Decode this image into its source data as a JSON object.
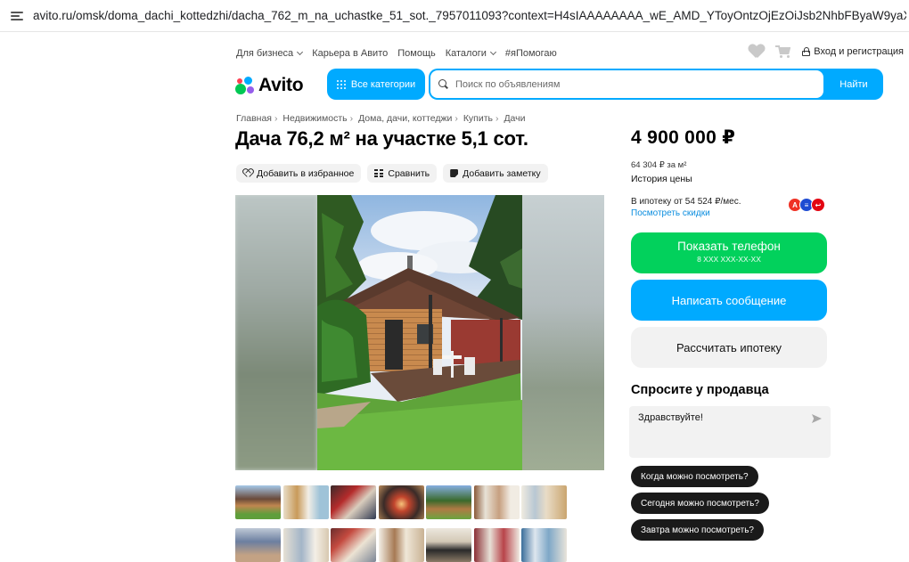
{
  "browser": {
    "url": "avito.ru/omsk/doma_dachi_kottedzhi/dacha_762_m_na_uchastke_51_sot._7957011093?context=H4sIAAAAAAAA_wE_AMD_YToyOntzOjEzOiJsb2NhbFByaW9yaXR5IjtiOjA7czoxOiJ4IjtzOjE2OiI"
  },
  "topnav": {
    "items": [
      {
        "label": "Для бизнеса",
        "dropdown": true
      },
      {
        "label": "Карьера в Авито",
        "dropdown": false
      },
      {
        "label": "Помощь",
        "dropdown": false
      },
      {
        "label": "Каталоги",
        "dropdown": true
      },
      {
        "label": "#яПомогаю",
        "dropdown": false
      }
    ],
    "login_label": "Вход и регистрация"
  },
  "header": {
    "logo_text": "Avito",
    "categories_label": "Все категории",
    "search_placeholder": "Поиск по объявлениям",
    "search_button": "Найти"
  },
  "breadcrumb": [
    "Главная",
    "Недвижимость",
    "Дома, дачи, коттеджи",
    "Купить",
    "Дачи"
  ],
  "listing": {
    "title": "Дача 76,2 м² на участке 5,1 сот.",
    "actions": {
      "favorite": "Добавить в избранное",
      "compare": "Сравнить",
      "note": "Добавить заметку"
    }
  },
  "sidebar": {
    "price": "4 900 000 ₽",
    "price_per_m": "64 304 ₽ за м²",
    "price_history": "История цены",
    "mortgage": "В ипотеку от 54 524 ₽/мес.",
    "discounts_link": "Посмотреть скидки",
    "banks": [
      {
        "letter": "А",
        "color": "#ef3124"
      },
      {
        "letter": "≡",
        "color": "#1e4bd2"
      },
      {
        "letter": "↩",
        "color": "#e30613"
      }
    ],
    "show_phone": "Показать телефон",
    "phone_mask": "8 XXX XXX-XX-XX",
    "write_message": "Написать сообщение",
    "calc_mortgage": "Рассчитать ипотеку",
    "ask_title": "Спросите у продавца",
    "message_text": "Здравствуйте!",
    "quick_questions": [
      "Когда можно посмотреть?",
      "Сегодня можно посмотреть?",
      "Завтра можно посмотреть?"
    ]
  },
  "colors": {
    "accent_blue": "#00aaff",
    "accent_green": "#02d15c"
  }
}
